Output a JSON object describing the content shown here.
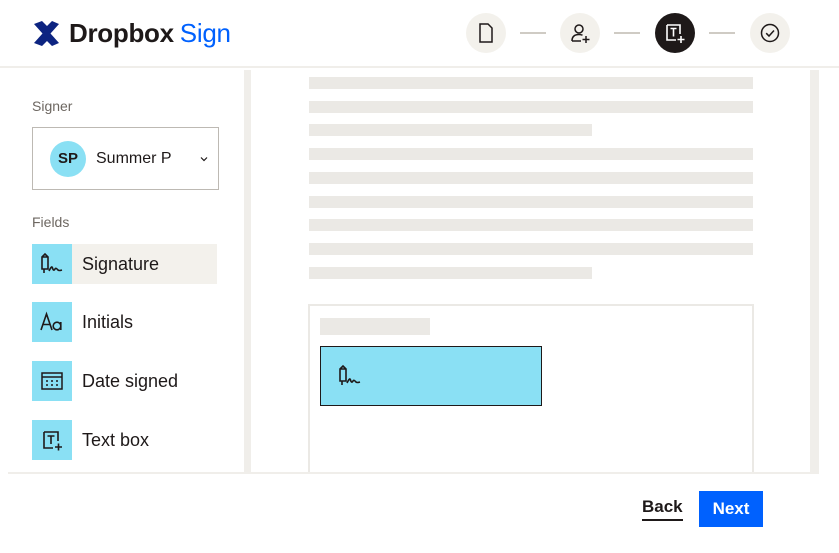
{
  "brand": {
    "name": "Dropbox",
    "product": "Sign",
    "accent_color": "#0061fe",
    "field_color": "#8ae0f4"
  },
  "steps": [
    {
      "icon": "document-icon",
      "active": false
    },
    {
      "icon": "add-signer-icon",
      "active": false
    },
    {
      "icon": "text-field-icon",
      "active": true
    },
    {
      "icon": "check-circle-icon",
      "active": false
    }
  ],
  "sidebar": {
    "signer_label": "Signer",
    "signer": {
      "initials": "SP",
      "name": "Summer P"
    },
    "fields_label": "Fields",
    "fields": [
      {
        "label": "Signature",
        "icon": "signature-icon",
        "selected": true
      },
      {
        "label": "Initials",
        "icon": "initials-icon",
        "selected": false
      },
      {
        "label": "Date signed",
        "icon": "calendar-icon",
        "selected": false
      },
      {
        "label": "Text box",
        "icon": "text-box-icon",
        "selected": false
      }
    ]
  },
  "footer": {
    "back_label": "Back",
    "next_label": "Next"
  }
}
